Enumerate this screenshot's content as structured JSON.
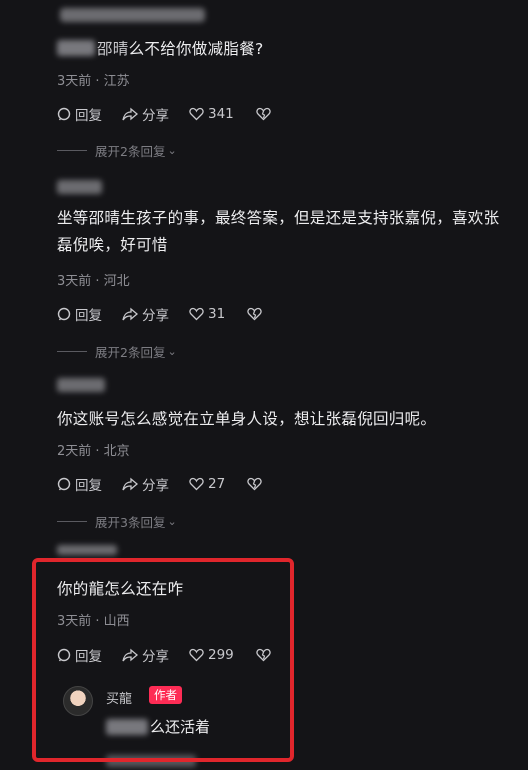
{
  "comments": [
    {
      "text": "么不给你做减脂餐?",
      "name_hint": "邵晴",
      "meta": "3天前 · 江苏",
      "reply": "回复",
      "share": "分享",
      "likes": "341",
      "expand": "展开2条回复"
    },
    {
      "text": "坐等邵晴生孩子的事，最终答案，但是还是支持张嘉倪，喜欢张磊倪唉，好可惜",
      "meta": "3天前 · 河北",
      "reply": "回复",
      "share": "分享",
      "likes": "31",
      "expand": "展开2条回复"
    },
    {
      "text": "你这账号怎么感觉在立单身人设，想让张磊倪回归呢。",
      "meta": "2天前 · 北京",
      "reply": "回复",
      "share": "分享",
      "likes": "27",
      "expand": "展开3条回复"
    },
    {
      "text": "你的龍怎么还在咋",
      "meta": "3天前 · 山西",
      "reply": "回复",
      "share": "分享",
      "likes": "299"
    }
  ],
  "author_reply": {
    "name": "买龍",
    "tag": "作者",
    "text": "么还活着"
  },
  "colors": {
    "highlight": "#e0262c",
    "author_tag": "#fe2c55"
  }
}
